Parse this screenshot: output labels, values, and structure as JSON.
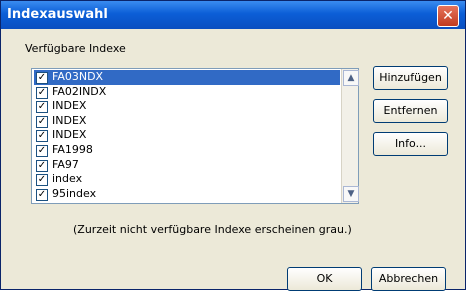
{
  "window": {
    "title": "Indexauswahl",
    "close_symbol": "✕"
  },
  "section_label": "Verfügbare Indexe",
  "list": {
    "items": [
      {
        "label": "FA03NDX",
        "checked": true,
        "selected": true
      },
      {
        "label": "FA02INDX",
        "checked": true,
        "selected": false
      },
      {
        "label": "INDEX",
        "checked": true,
        "selected": false
      },
      {
        "label": "INDEX",
        "checked": true,
        "selected": false
      },
      {
        "label": "INDEX",
        "checked": true,
        "selected": false
      },
      {
        "label": "FA1998",
        "checked": true,
        "selected": false
      },
      {
        "label": "FA97",
        "checked": true,
        "selected": false
      },
      {
        "label": "index",
        "checked": true,
        "selected": false
      },
      {
        "label": "95index",
        "checked": true,
        "selected": false
      }
    ]
  },
  "buttons": {
    "hinzufuegen": "Hinzufügen",
    "entfernen": "Entfernen",
    "info": "Info...",
    "ok": "OK",
    "abbrechen": "Abbrechen"
  },
  "hint": "(Zurzeit nicht verfügbare Indexe erscheinen grau.)",
  "icons": {
    "checkbox": "checkbox-icon",
    "scroll_up": "chevron-up-icon",
    "scroll_down": "chevron-down-icon"
  }
}
